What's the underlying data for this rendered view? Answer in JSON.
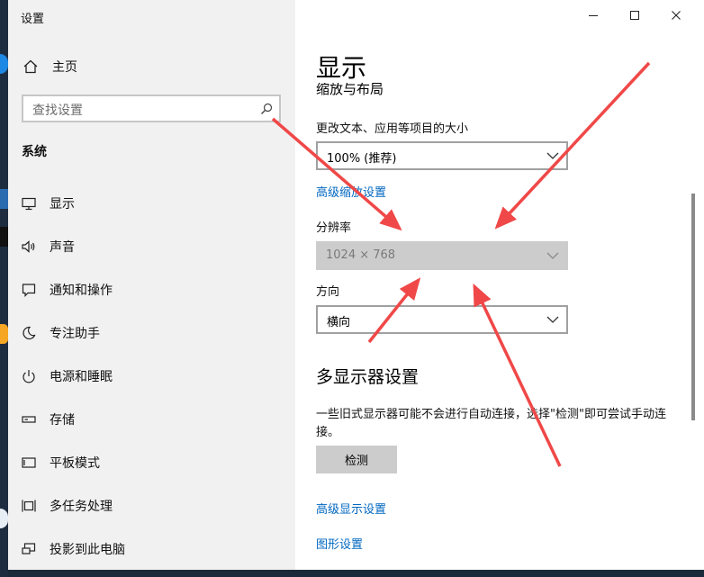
{
  "window": {
    "title": "设置",
    "controls": {
      "minimize": "minimize-icon",
      "maximize": "maximize-icon",
      "close": "close-icon"
    }
  },
  "nav": {
    "home_label": "主页",
    "search_placeholder": "查找设置",
    "section_title": "系统",
    "items": [
      {
        "label": "显示",
        "icon": "monitor-icon"
      },
      {
        "label": "声音",
        "icon": "speaker-icon"
      },
      {
        "label": "通知和操作",
        "icon": "notification-icon"
      },
      {
        "label": "专注助手",
        "icon": "moon-icon"
      },
      {
        "label": "电源和睡眠",
        "icon": "power-icon"
      },
      {
        "label": "存储",
        "icon": "storage-icon"
      },
      {
        "label": "平板模式",
        "icon": "tablet-icon"
      },
      {
        "label": "多任务处理",
        "icon": "multitask-icon"
      },
      {
        "label": "投影到此电脑",
        "icon": "project-icon"
      }
    ]
  },
  "main": {
    "page_title": "显示",
    "clipped_heading": "缩放与布局",
    "scale_label": "更改文本、应用等项目的大小",
    "scale_value": "100% (推荐)",
    "advanced_scaling_link": "高级缩放设置",
    "resolution_label": "分辨率",
    "resolution_value": "1024 × 768",
    "orientation_label": "方向",
    "orientation_value": "横向",
    "multi_display_heading": "多显示器设置",
    "multi_display_text": "一些旧式显示器可能不会进行自动连接，选择\"检测\"即可尝试手动连接。",
    "detect_button": "检测",
    "advanced_display_link": "高级显示设置",
    "graphics_link": "图形设置"
  },
  "colors": {
    "link": "#0067c0",
    "nav_bg": "#f1f1f1",
    "disabled_bg": "#cccccc",
    "annotation_arrow": "#f04848"
  }
}
